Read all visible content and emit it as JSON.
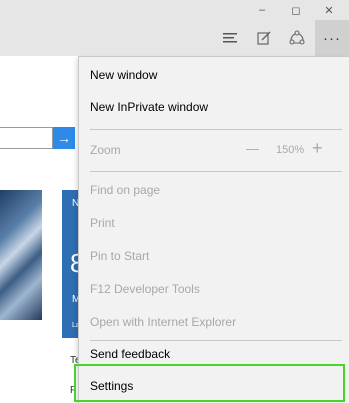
{
  "window": {
    "minimize_glyph": "–",
    "maximize_glyph": "◻",
    "close_glyph": "✕"
  },
  "toolbar": {
    "hub_icon": "hub-icon",
    "note_icon": "web-note-icon",
    "share_icon": "share-icon",
    "more_glyph": "···"
  },
  "background": {
    "tile_letter_n": "N",
    "tile_number": "8",
    "tile_letter_m": "M",
    "tile_small": "La",
    "frag_te": "Te",
    "frag_fi": "F"
  },
  "menu": {
    "new_window": "New window",
    "new_inprivate": "New InPrivate window",
    "zoom_label": "Zoom",
    "zoom_minus": "—",
    "zoom_value": "150%",
    "zoom_plus": "+",
    "find": "Find on page",
    "print": "Print",
    "pin": "Pin to Start",
    "f12": "F12 Developer Tools",
    "open_ie": "Open with Internet Explorer",
    "feedback": "Send feedback",
    "settings": "Settings"
  },
  "colors": {
    "highlight": "#4ad42a",
    "accent": "#2d8ae6"
  }
}
